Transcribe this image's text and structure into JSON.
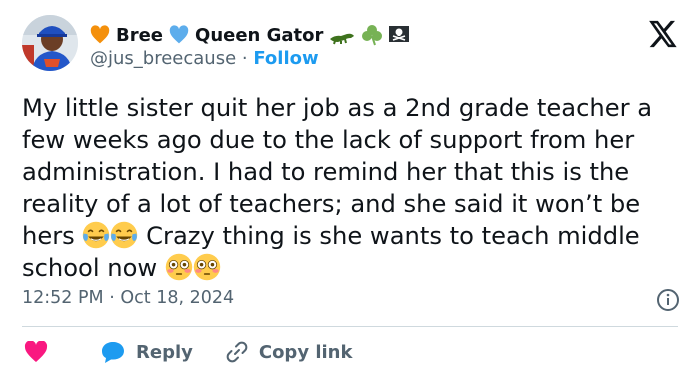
{
  "author": {
    "display_name_part1": "Bree",
    "display_name_part2": "Queen Gator",
    "handle": "@jus_breecause",
    "separator": "·",
    "follow_label": "Follow"
  },
  "tweet": {
    "text_part1": "My little sister quit her job as a 2nd grade teacher a few weeks ago due to the lack of support from her administration. I had to remind her that this is the reality of a lot of teachers; and she said it won’t be hers ",
    "text_part2": " Crazy thing is she wants to teach middle school now ",
    "time": "12:52 PM",
    "time_separator": "·",
    "date": "Oct 18, 2024"
  },
  "actions": {
    "reply_label": "Reply",
    "copy_link_label": "Copy link"
  },
  "icons": {
    "orange_heart": "orange-heart-icon",
    "blue_heart": "blue-heart-icon",
    "crocodile": "crocodile-icon",
    "shamrock": "shamrock-icon",
    "pirate_flag": "pirate-flag-icon",
    "x_logo": "x-logo-icon",
    "joy_emoji": "face-with-tears-of-joy-icon",
    "flushed_emoji": "flushed-face-icon",
    "info": "info-icon",
    "like": "heart-icon",
    "reply": "reply-bubble-icon",
    "copy_link": "link-icon"
  },
  "colors": {
    "link_blue": "#1d9bf0",
    "like_red": "#f91880",
    "secondary_text": "#536471"
  }
}
